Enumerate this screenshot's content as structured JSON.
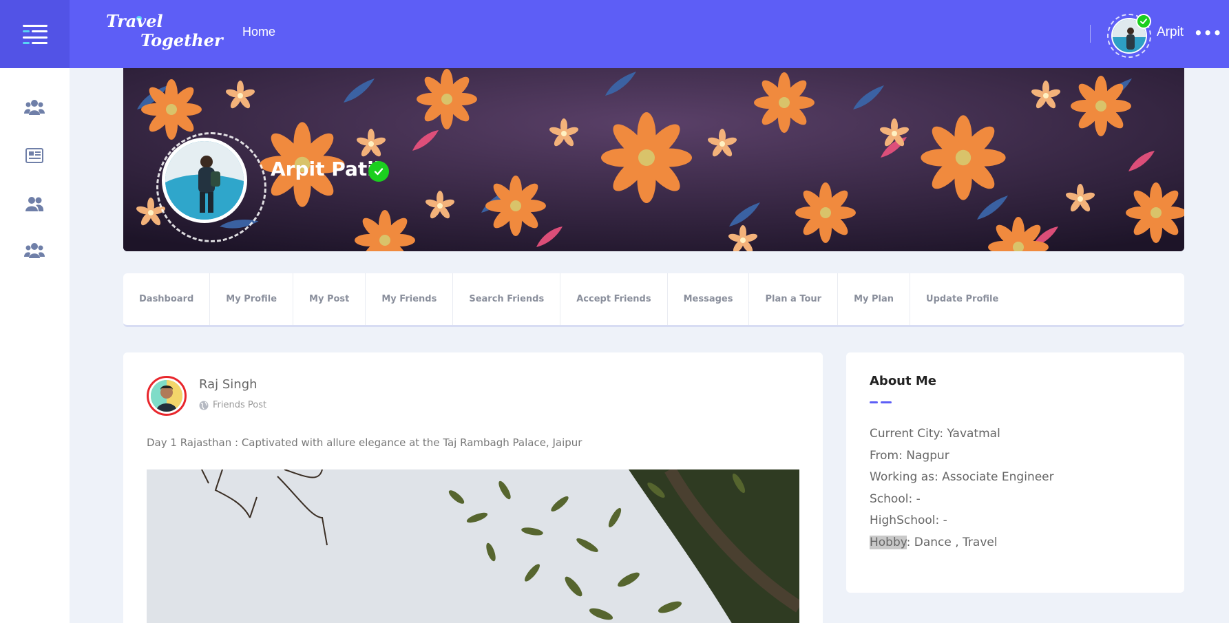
{
  "header": {
    "logo_text_line1": "Travel",
    "logo_text_line2": "Together",
    "nav_home": "Home",
    "user_name": "Arpit",
    "more_label": "•••"
  },
  "sidebar": {
    "items": [
      {
        "icon": "groups-icon"
      },
      {
        "icon": "newspaper-icon"
      },
      {
        "icon": "friends-icon"
      },
      {
        "icon": "community-icon"
      }
    ]
  },
  "profile": {
    "name": "Arpit Patil",
    "verified": true
  },
  "tabs": [
    {
      "label": "Dashboard"
    },
    {
      "label": "My Profile"
    },
    {
      "label": "My Post"
    },
    {
      "label": "My Friends"
    },
    {
      "label": "Search Friends"
    },
    {
      "label": "Accept Friends"
    },
    {
      "label": "Messages"
    },
    {
      "label": "Plan a Tour"
    },
    {
      "label": "My Plan"
    },
    {
      "label": "Update Profile"
    }
  ],
  "post": {
    "author": "Raj Singh",
    "visibility": "Friends Post",
    "text": "Day 1 Rajasthan : Captivated with allure elegance at the Taj Rambagh Palace, Jaipur"
  },
  "about": {
    "title": "About Me",
    "items": [
      {
        "label": "Current City",
        "value": "Yavatmal"
      },
      {
        "label": "From",
        "value": "Nagpur"
      },
      {
        "label": "Working as",
        "value": "Associate Engineer"
      },
      {
        "label": "School",
        "value": "-"
      },
      {
        "label": "HighSchool",
        "value": "-"
      },
      {
        "label": "Hobby",
        "value": "Dance , Travel"
      }
    ]
  },
  "colors": {
    "primary": "#5d5ef6",
    "verified": "#1bcf1f",
    "background": "#eef2f9"
  }
}
